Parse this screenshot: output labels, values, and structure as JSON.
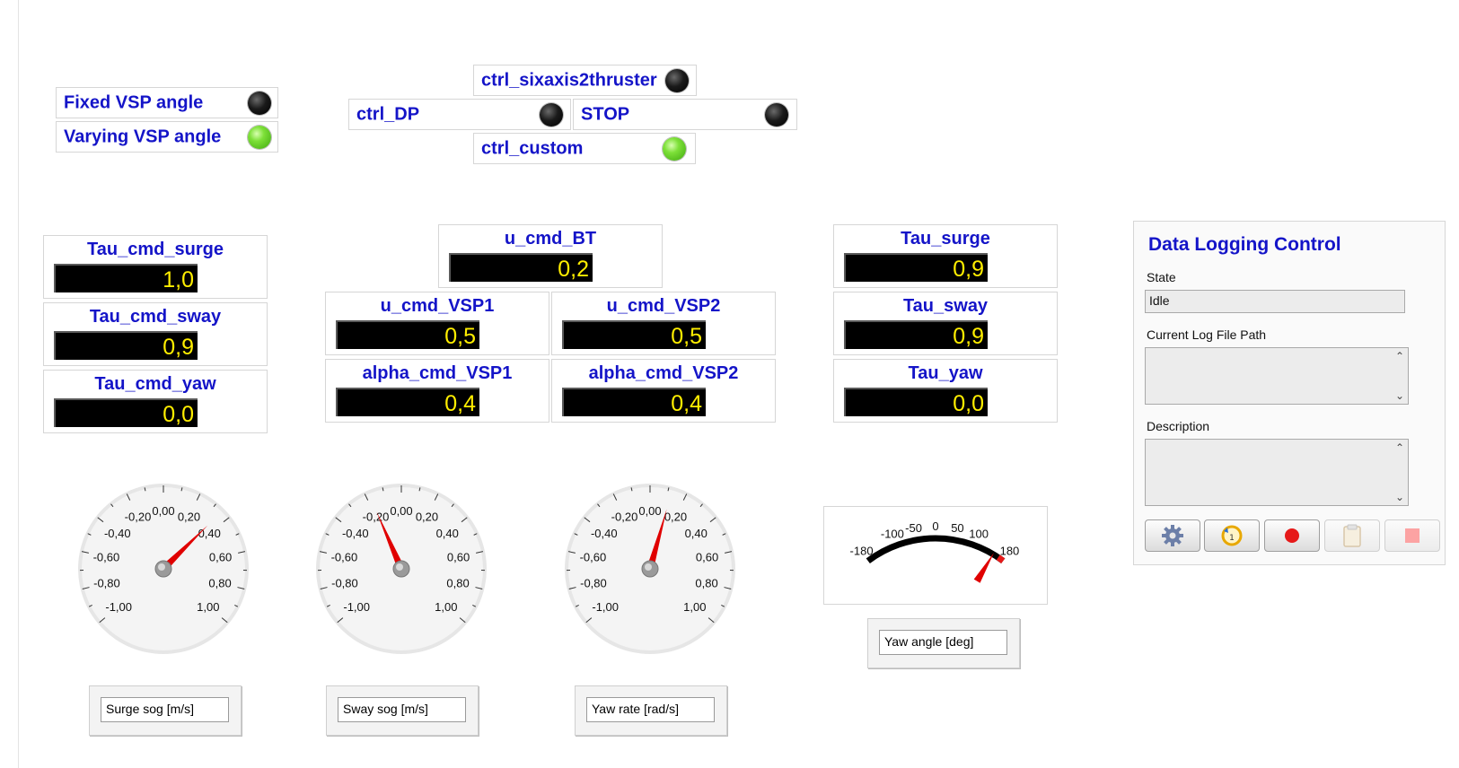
{
  "vsp_mode": {
    "fixed_label": "Fixed VSP angle",
    "varying_label": "Varying VSP angle",
    "fixed_on": false,
    "varying_on": true
  },
  "controllers": {
    "sixaxis_label": "ctrl_sixaxis2thruster",
    "dp_label": "ctrl_DP",
    "stop_label": "STOP",
    "custom_label": "ctrl_custom",
    "sixaxis_on": false,
    "dp_on": false,
    "stop_on": false,
    "custom_on": true
  },
  "tau_cmd": {
    "surge": {
      "label": "Tau_cmd_surge",
      "value": "1,0"
    },
    "sway": {
      "label": "Tau_cmd_sway",
      "value": "0,9"
    },
    "yaw": {
      "label": "Tau_cmd_yaw",
      "value": "0,0"
    }
  },
  "u_cmd": {
    "bt": {
      "label": "u_cmd_BT",
      "value": "0,2"
    },
    "vsp1": {
      "label": "u_cmd_VSP1",
      "value": "0,5"
    },
    "vsp2": {
      "label": "u_cmd_VSP2",
      "value": "0,5"
    },
    "alpha1": {
      "label": "alpha_cmd_VSP1",
      "value": "0,4"
    },
    "alpha2": {
      "label": "alpha_cmd_VSP2",
      "value": "0,4"
    }
  },
  "tau": {
    "surge": {
      "label": "Tau_surge",
      "value": "0,9"
    },
    "sway": {
      "label": "Tau_sway",
      "value": "0,9"
    },
    "yaw": {
      "label": "Tau_yaw",
      "value": "0,0"
    }
  },
  "gauge_scale_labels": [
    "-1,00",
    "-0,80",
    "-0,60",
    "-0,40",
    "-0,20",
    "0,00",
    "0,20",
    "0,40",
    "0,60",
    "0,80",
    "1,00"
  ],
  "gauges": [
    {
      "caption": "Surge sog [m/s]",
      "value": 0.35
    },
    {
      "caption": "Sway sog [m/s]",
      "value": -0.18
    },
    {
      "caption": "Yaw rate [rad/s]",
      "value": 0.12
    }
  ],
  "yaw_meter": {
    "caption": "Yaw angle [deg]",
    "value": 150,
    "scale_labels": [
      "-180",
      "-100",
      "-50",
      "0",
      "50",
      "100",
      "180"
    ]
  },
  "data_logging": {
    "title": "Data Logging Control",
    "state_label": "State",
    "state_value": "Idle",
    "path_label": "Current Log File Path",
    "path_value": "",
    "description_label": "Description",
    "description_value": "",
    "buttons": [
      "gear-icon",
      "refresh-icon",
      "record-icon",
      "clipboard-icon",
      "stop-icon"
    ]
  },
  "colors": {
    "label_blue": "#1414c8",
    "value_yellow": "#ffee00",
    "led_green": "#55c020",
    "needle_red": "#e00000"
  }
}
